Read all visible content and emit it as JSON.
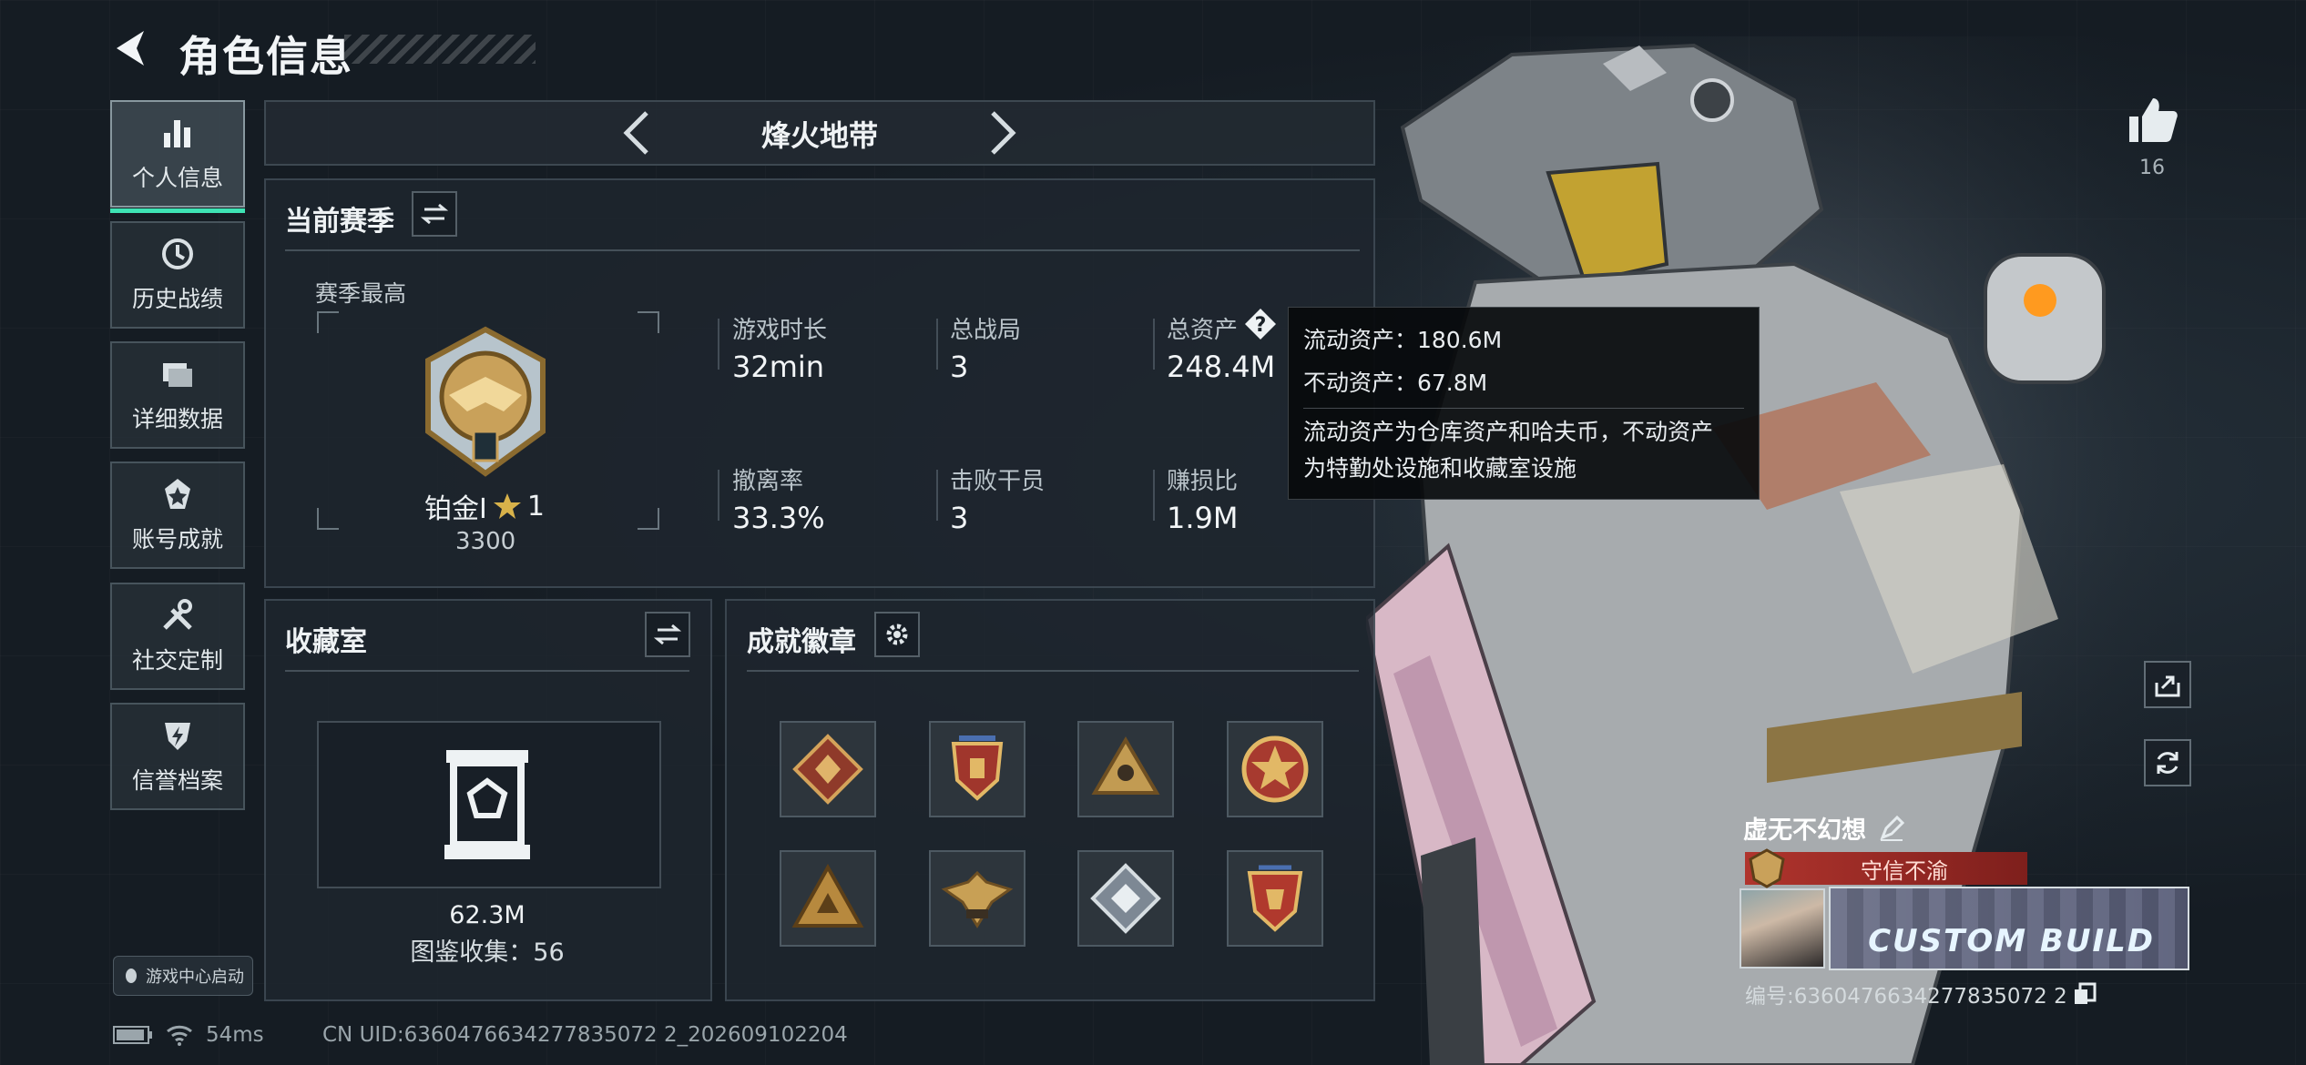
{
  "header": {
    "title": "角色信息"
  },
  "sidebar": {
    "items": [
      {
        "label": "个人信息",
        "icon": "bar-chart-icon"
      },
      {
        "label": "历史战绩",
        "icon": "clock-icon"
      },
      {
        "label": "详细数据",
        "icon": "folders-icon"
      },
      {
        "label": "账号成就",
        "icon": "achievement-icon"
      },
      {
        "label": "社交定制",
        "icon": "tools-icon"
      },
      {
        "label": "信誉档案",
        "icon": "shield-bolt-icon"
      }
    ],
    "game_center_label": "游戏中心启动"
  },
  "mode": {
    "label": "烽火地带"
  },
  "season": {
    "title": "当前赛季",
    "best_label": "赛季最高",
    "rank_name": "铂金Ⅰ",
    "rank_stars": "1",
    "rank_score": "3300",
    "stats": [
      {
        "label": "游戏时长",
        "value": "32min"
      },
      {
        "label": "总战局",
        "value": "3"
      },
      {
        "label": "总资产",
        "value": "248.4M"
      },
      {
        "label": "撤离率",
        "value": "33.3%"
      },
      {
        "label": "击败干员",
        "value": "3"
      },
      {
        "label": "赚损比",
        "value": "1.9M"
      }
    ]
  },
  "tooltip": {
    "liquid": "流动资产：180.6M",
    "fixed": "不动资产：67.8M",
    "desc_line1": "流动资产为仓库资产和哈夫币，不动资产",
    "desc_line2": "为特勤处设施和收藏室设施"
  },
  "collection": {
    "title": "收藏室",
    "value": "62.3M",
    "catalog": "图鉴收集：56"
  },
  "achievements": {
    "title": "成就徽章",
    "badges": [
      "dragon-badge-icon",
      "shield-badge-icon",
      "pyramid-badge-icon",
      "star-badge-icon",
      "triangle-badge-icon",
      "wings-badge-icon",
      "gem-badge-icon",
      "crest-badge-icon"
    ]
  },
  "likes": {
    "count": "16"
  },
  "profile": {
    "name": "虚无不幻想",
    "creed": "守信不渝",
    "banner_text": "CUSTOM BUILD",
    "id_text": "编号:6360476634277835072 2"
  },
  "footer": {
    "ping": "54ms",
    "uid": "CN UID:6360476634277835072 2_202609102204"
  },
  "colors": {
    "accent": "#3ee3b4",
    "panel": "#1e262e",
    "creed_red": "#b0342d",
    "gold": "#c9a15a"
  }
}
